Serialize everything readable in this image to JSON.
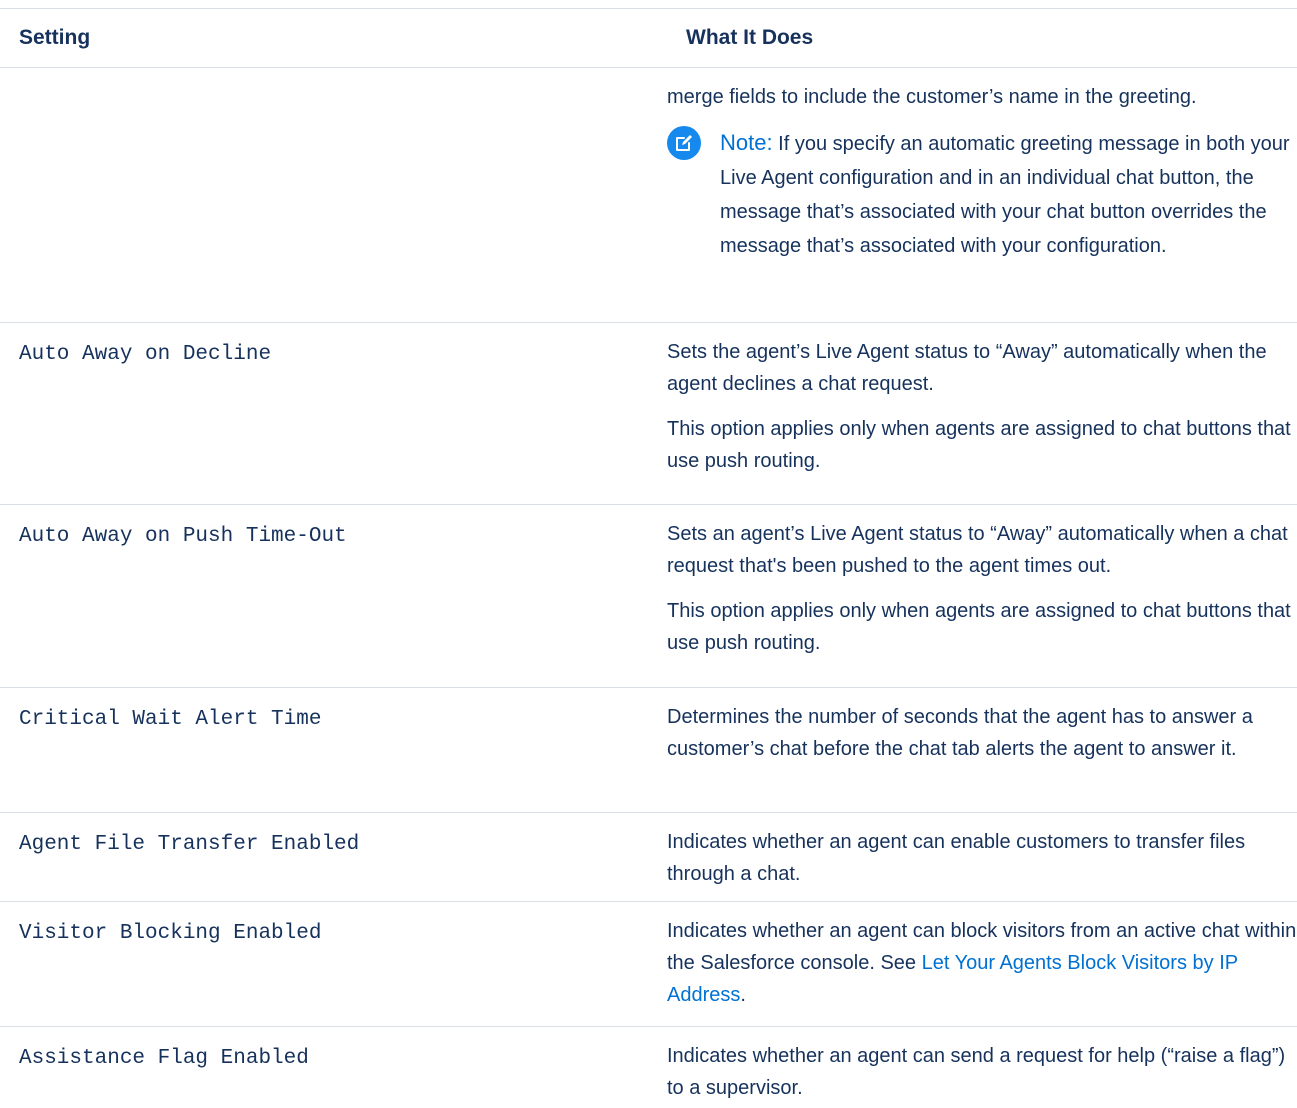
{
  "table": {
    "header": {
      "setting": "Setting",
      "what_it_does": "What It Does"
    },
    "continuation": {
      "text": "merge fields to include the customer’s name in the greeting.",
      "note_label": "Note:",
      "note_text": "If you specify an automatic greeting message in both your Live Agent configuration and in an individual chat button, the message that’s associated with your chat button overrides the message that’s associated with your configuration."
    },
    "rows": [
      {
        "setting": "Auto Away on Decline",
        "p1": "Sets the agent’s Live Agent status to “Away” automatically when the agent declines a chat request.",
        "p2": "This option applies only when agents are assigned to chat buttons that use push routing."
      },
      {
        "setting": "Auto Away on Push Time-Out",
        "p1": "Sets an agent’s Live Agent status to “Away” automatically when a chat request that's been pushed to the agent times out.",
        "p2": "This option applies only when agents are assigned to chat buttons that use push routing."
      },
      {
        "setting": "Critical Wait Alert Time",
        "p1": "Determines the number of seconds that the agent has to answer a customer’s chat before the chat tab alerts the agent to answer it."
      },
      {
        "setting": "Agent File Transfer Enabled",
        "p1": "Indicates whether an agent can enable customers to transfer files through a chat."
      },
      {
        "setting": "Visitor Blocking Enabled",
        "p1_before": "Indicates whether an agent can block visitors from an active chat within the Salesforce console. See ",
        "p1_link": "Let Your Agents Block Visitors by IP Address",
        "p1_after": "."
      },
      {
        "setting": "Assistance Flag Enabled",
        "p1": "Indicates whether an agent can send a request for help (“raise a flag”) to a supervisor."
      }
    ]
  },
  "icons": {
    "note": "edit-note-icon"
  },
  "colors": {
    "text": "#16325c",
    "link": "#0070d2",
    "note_icon_bg": "#1589ee",
    "border": "#d8dde6"
  }
}
